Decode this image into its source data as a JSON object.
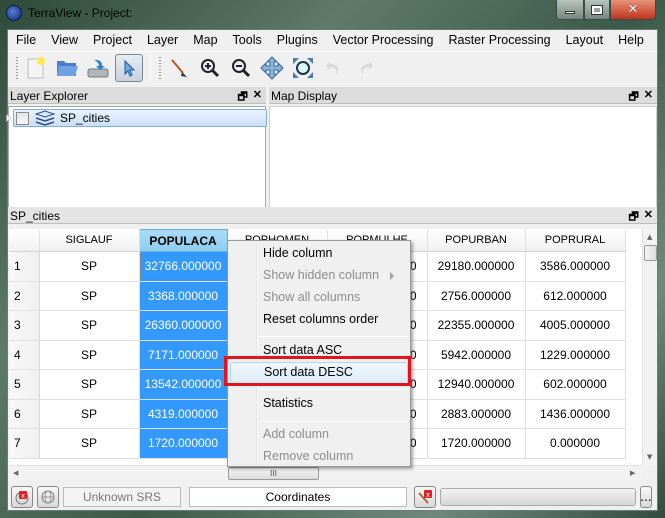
{
  "window": {
    "title": "TerraView - Project:",
    "controls": {
      "minimize": "minimize",
      "maximize": "maximize",
      "close": "close"
    }
  },
  "menubar": [
    "File",
    "View",
    "Project",
    "Layer",
    "Map",
    "Tools",
    "Plugins",
    "Vector Processing",
    "Raster Processing",
    "Layout",
    "Help"
  ],
  "toolbar": {
    "buttons": [
      {
        "name": "new-project",
        "icon": "new-document-icon"
      },
      {
        "name": "open-project",
        "icon": "folder-open-icon"
      },
      {
        "name": "save-project",
        "icon": "save-drive-icon"
      },
      {
        "name": "select",
        "icon": "pointer-arrow-icon",
        "active": true
      },
      {
        "name": "draw",
        "icon": "paintbrush-icon"
      },
      {
        "name": "zoom-in",
        "icon": "zoom-in-icon"
      },
      {
        "name": "zoom-out",
        "icon": "zoom-out-icon"
      },
      {
        "name": "pan",
        "icon": "pan-arrows-icon"
      },
      {
        "name": "zoom-extent",
        "icon": "zoom-extent-icon"
      },
      {
        "name": "undo",
        "icon": "undo-icon",
        "disabled": true
      },
      {
        "name": "redo",
        "icon": "redo-icon",
        "disabled": true
      }
    ]
  },
  "layer_explorer": {
    "title": "Layer Explorer",
    "layers": [
      {
        "label": "SP_cities",
        "checked": false,
        "selected": true
      }
    ]
  },
  "map_display": {
    "title": "Map Display"
  },
  "table_panel": {
    "title": "SP_cities",
    "columns": [
      "SIGLAUF",
      "POPULACA",
      "POPHOMEN",
      "POPMULHE",
      "POPURBAN",
      "POPRURAL"
    ],
    "selected_column": "POPULACA",
    "rows": [
      {
        "id": "1",
        "SIGLAUF": "SP",
        "POPULACA": "32766.000000",
        "POPHOMEN": "",
        "POPMULHE": "00",
        "POPURBAN": "29180.000000",
        "POPRURAL": "3586.000000"
      },
      {
        "id": "2",
        "SIGLAUF": "SP",
        "POPULACA": "3368.000000",
        "POPHOMEN": "",
        "POPMULHE": "00",
        "POPURBAN": "2756.000000",
        "POPRURAL": "612.000000"
      },
      {
        "id": "3",
        "SIGLAUF": "SP",
        "POPULACA": "26360.000000",
        "POPHOMEN": "",
        "POPMULHE": "00",
        "POPURBAN": "22355.000000",
        "POPRURAL": "4005.000000"
      },
      {
        "id": "4",
        "SIGLAUF": "SP",
        "POPULACA": "7171.000000",
        "POPHOMEN": "",
        "POPMULHE": "00",
        "POPURBAN": "5942.000000",
        "POPRURAL": "1229.000000"
      },
      {
        "id": "5",
        "SIGLAUF": "SP",
        "POPULACA": "13542.000000",
        "POPHOMEN": "",
        "POPMULHE": "00",
        "POPURBAN": "12940.000000",
        "POPRURAL": "602.000000"
      },
      {
        "id": "6",
        "SIGLAUF": "SP",
        "POPULACA": "4319.000000",
        "POPHOMEN": "",
        "POPMULHE": "00",
        "POPURBAN": "2883.000000",
        "POPRURAL": "1436.000000"
      },
      {
        "id": "7",
        "SIGLAUF": "SP",
        "POPULACA": "1720.000000",
        "POPHOMEN": "",
        "POPMULHE": "0",
        "POPURBAN": "1720.000000",
        "POPRURAL": "0.000000"
      }
    ],
    "hscroll_thumb": "III"
  },
  "context_menu": {
    "items": [
      {
        "label": "Hide column",
        "disabled": false
      },
      {
        "label": "Show hidden column",
        "disabled": true,
        "submenu": true
      },
      {
        "label": "Show all columns",
        "disabled": true
      },
      {
        "label": "Reset columns order",
        "disabled": false
      },
      {
        "separator": true
      },
      {
        "label": "Sort data ASC",
        "disabled": false
      },
      {
        "label": "Sort data DESC",
        "disabled": false,
        "hover": true,
        "highlighted": true
      },
      {
        "separator": true
      },
      {
        "label": "Statistics",
        "disabled": false
      },
      {
        "separator": true
      },
      {
        "label": "Add column",
        "disabled": true
      },
      {
        "label": "Remove column",
        "disabled": true
      }
    ],
    "highlight_color": "#e4141c"
  },
  "statusbar": {
    "srs_label": "Unknown SRS",
    "coordinates_label": "Coordinates",
    "more_button": "..."
  },
  "colors": {
    "selection": "#3399ff",
    "selected_header": "#8ecdf0",
    "close_button": "#c0341c"
  }
}
